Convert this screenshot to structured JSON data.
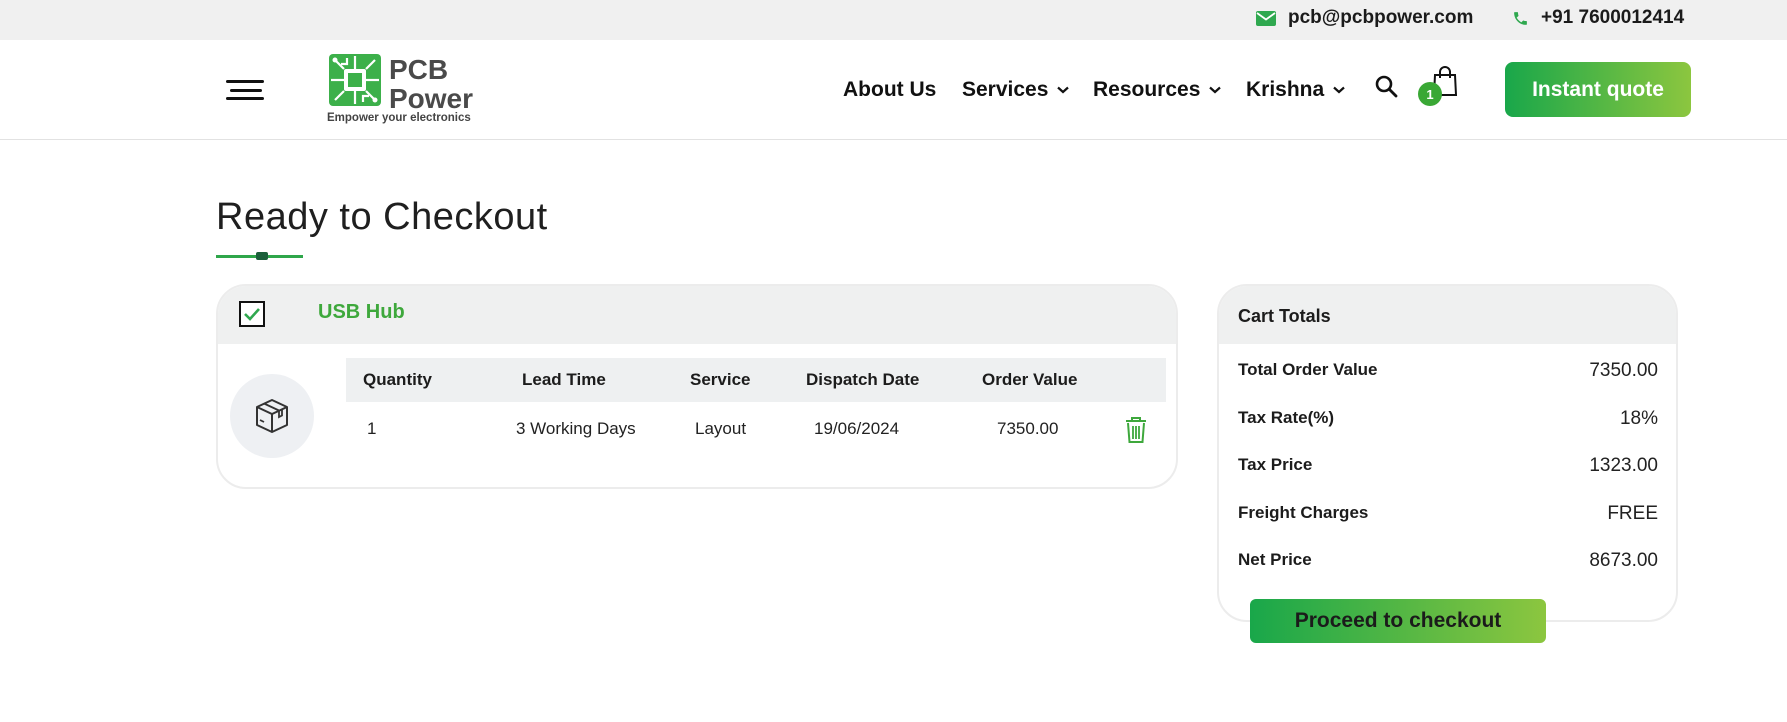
{
  "topbar": {
    "email": "pcb@pcbpower.com",
    "phone": "+91 7600012414",
    "email_icon": "envelope-icon",
    "phone_icon": "phone-icon"
  },
  "header": {
    "logo": {
      "line1": "PCB",
      "line2": "Power",
      "tagline": "Empower your electronics"
    },
    "nav": {
      "about": "About Us",
      "services": "Services",
      "resources": "Resources",
      "user": "Krishna"
    },
    "cart_count": "1",
    "quote_label": "Instant quote"
  },
  "page": {
    "title": "Ready to Checkout"
  },
  "order": {
    "product_name": "USB Hub",
    "checked": true,
    "thumb_icon": "package-box-icon",
    "columns": {
      "quantity": "Quantity",
      "lead_time": "Lead Time",
      "service": "Service",
      "dispatch_date": "Dispatch Date",
      "order_value": "Order Value"
    },
    "row": {
      "quantity": "1",
      "lead_time": "3 Working Days",
      "service": "Layout",
      "dispatch_date": "19/06/2024",
      "order_value": "7350.00"
    }
  },
  "totals": {
    "title": "Cart Totals",
    "rows": [
      {
        "label": "Total Order Value",
        "value": "7350.00"
      },
      {
        "label": "Tax Rate(%)",
        "value": "18%"
      },
      {
        "label": "Tax Price",
        "value": "1323.00"
      },
      {
        "label": "Freight Charges",
        "value": "FREE"
      },
      {
        "label": "Net Price",
        "value": "8673.00"
      }
    ],
    "checkout_label": "Proceed to checkout"
  },
  "colors": {
    "brand_green": "#3ea83c",
    "gradient_start": "#19a74a",
    "gradient_end": "#8cc63f"
  }
}
